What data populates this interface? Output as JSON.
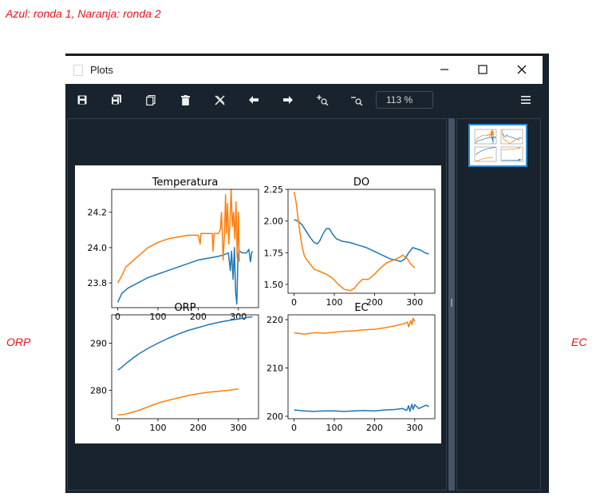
{
  "annotations": {
    "top": "Azul: ronda 1, Naranja: ronda 2",
    "left": "ORP",
    "right": "EC",
    "color": "#e8141b"
  },
  "window": {
    "title": "Plots",
    "minimize_icon": "minimize-icon",
    "maximize_icon": "maximize-icon",
    "close_icon": "close-icon"
  },
  "toolbar": {
    "buttons": [
      "save-icon",
      "save-all-icon",
      "copy-icon",
      "trash-icon",
      "close-all-icon",
      "arrow-left-icon",
      "arrow-right-icon",
      "zoom-in-icon",
      "zoom-out-icon"
    ],
    "zoom_value": "113 %",
    "menu_icon": "hamburger-menu-icon"
  },
  "colors": {
    "series1": "#1f77b4",
    "series2": "#ff7f0e",
    "pane_bg": "#19232d",
    "thumbnail_border": "#2d8ad6"
  },
  "chart_data": [
    {
      "type": "line",
      "title": "Temperatura",
      "xlim": [
        -15,
        350
      ],
      "ylim": [
        23.66,
        24.33
      ],
      "xticks": [
        0,
        100,
        200,
        300
      ],
      "yticks": [
        23.8,
        24.0,
        24.2
      ],
      "ytick_labels": [
        "23.8",
        "24.0",
        "24.2"
      ],
      "series": [
        {
          "color": "#1f77b4",
          "points": [
            [
              0,
              23.69
            ],
            [
              10,
              23.74
            ],
            [
              25,
              23.77
            ],
            [
              50,
              23.8
            ],
            [
              75,
              23.83
            ],
            [
              100,
              23.85
            ],
            [
              125,
              23.87
            ],
            [
              150,
              23.89
            ],
            [
              175,
              23.91
            ],
            [
              200,
              23.93
            ],
            [
              225,
              23.94
            ],
            [
              250,
              23.95
            ],
            [
              265,
              23.96
            ],
            [
              275,
              23.97
            ],
            [
              280,
              23.87
            ],
            [
              283,
              23.98
            ],
            [
              287,
              23.82
            ],
            [
              290,
              24.0
            ],
            [
              293,
              23.75
            ],
            [
              296,
              23.68
            ],
            [
              299,
              23.96
            ],
            [
              303,
              23.98
            ],
            [
              310,
              23.97
            ],
            [
              320,
              23.97
            ],
            [
              326,
              23.99
            ],
            [
              330,
              23.92
            ],
            [
              333,
              23.97
            ],
            [
              335,
              23.98
            ]
          ]
        },
        {
          "color": "#ff7f0e",
          "points": [
            [
              0,
              23.8
            ],
            [
              10,
              23.84
            ],
            [
              20,
              23.89
            ],
            [
              50,
              23.95
            ],
            [
              75,
              24.0
            ],
            [
              100,
              24.03
            ],
            [
              125,
              24.05
            ],
            [
              150,
              24.06
            ],
            [
              175,
              24.07
            ],
            [
              200,
              24.07
            ],
            [
              205,
              24.02
            ],
            [
              207,
              24.08
            ],
            [
              235,
              24.08
            ],
            [
              237,
              23.98
            ],
            [
              240,
              24.08
            ],
            [
              250,
              24.08
            ],
            [
              255,
              24.1
            ],
            [
              258,
              24.2
            ],
            [
              260,
              24.08
            ],
            [
              262,
              23.93
            ],
            [
              265,
              24.06
            ],
            [
              268,
              24.3
            ],
            [
              270,
              24.08
            ],
            [
              273,
              24.25
            ],
            [
              276,
              24.02
            ],
            [
              279,
              24.14
            ],
            [
              282,
              24.33
            ],
            [
              285,
              24.12
            ],
            [
              288,
              24.2
            ],
            [
              291,
              24.05
            ],
            [
              294,
              24.26
            ],
            [
              297,
              23.94
            ],
            [
              300,
              24.2
            ],
            [
              302,
              23.92
            ]
          ]
        }
      ]
    },
    {
      "type": "line",
      "title": "DO",
      "xlim": [
        -15,
        350
      ],
      "ylim": [
        1.43,
        2.25
      ],
      "xticks": [
        0,
        100,
        200,
        300
      ],
      "yticks": [
        1.5,
        1.75,
        2.0,
        2.25
      ],
      "ytick_labels": [
        "1.50",
        "1.75",
        "2.00",
        "2.25"
      ],
      "series": [
        {
          "color": "#1f77b4",
          "points": [
            [
              0,
              2.01
            ],
            [
              10,
              2.0
            ],
            [
              20,
              1.97
            ],
            [
              30,
              1.92
            ],
            [
              40,
              1.87
            ],
            [
              50,
              1.83
            ],
            [
              58,
              1.82
            ],
            [
              65,
              1.85
            ],
            [
              72,
              1.9
            ],
            [
              80,
              1.94
            ],
            [
              88,
              1.94
            ],
            [
              95,
              1.9
            ],
            [
              105,
              1.86
            ],
            [
              120,
              1.84
            ],
            [
              140,
              1.83
            ],
            [
              160,
              1.81
            ],
            [
              180,
              1.79
            ],
            [
              200,
              1.76
            ],
            [
              220,
              1.73
            ],
            [
              240,
              1.7
            ],
            [
              255,
              1.69
            ],
            [
              265,
              1.68
            ],
            [
              275,
              1.7
            ],
            [
              285,
              1.75
            ],
            [
              295,
              1.79
            ],
            [
              305,
              1.78
            ],
            [
              315,
              1.77
            ],
            [
              325,
              1.75
            ],
            [
              335,
              1.74
            ]
          ]
        },
        {
          "color": "#ff7f0e",
          "points": [
            [
              0,
              2.23
            ],
            [
              5,
              2.15
            ],
            [
              10,
              2.02
            ],
            [
              15,
              1.9
            ],
            [
              20,
              1.8
            ],
            [
              25,
              1.73
            ],
            [
              30,
              1.7
            ],
            [
              40,
              1.66
            ],
            [
              50,
              1.62
            ],
            [
              65,
              1.6
            ],
            [
              80,
              1.58
            ],
            [
              95,
              1.55
            ],
            [
              110,
              1.5
            ],
            [
              125,
              1.46
            ],
            [
              140,
              1.45
            ],
            [
              150,
              1.47
            ],
            [
              160,
              1.51
            ],
            [
              170,
              1.54
            ],
            [
              185,
              1.54
            ],
            [
              200,
              1.58
            ],
            [
              215,
              1.63
            ],
            [
              230,
              1.67
            ],
            [
              245,
              1.69
            ],
            [
              260,
              1.71
            ],
            [
              270,
              1.73
            ],
            [
              280,
              1.71
            ],
            [
              290,
              1.66
            ],
            [
              300,
              1.63
            ]
          ]
        }
      ]
    },
    {
      "type": "line",
      "title": "ORP",
      "xlim": [
        -15,
        350
      ],
      "ylim": [
        274,
        296
      ],
      "xticks": [
        0,
        100,
        200,
        300
      ],
      "yticks": [
        280,
        290
      ],
      "ytick_labels": [
        "280",
        "290"
      ],
      "series": [
        {
          "color": "#1f77b4",
          "points": [
            [
              0,
              284.3
            ],
            [
              10,
              284.9
            ],
            [
              25,
              286.0
            ],
            [
              50,
              287.6
            ],
            [
              75,
              288.9
            ],
            [
              100,
              290.0
            ],
            [
              125,
              291.0
            ],
            [
              150,
              291.9
            ],
            [
              175,
              292.7
            ],
            [
              200,
              293.3
            ],
            [
              225,
              293.9
            ],
            [
              250,
              294.4
            ],
            [
              275,
              294.8
            ],
            [
              300,
              295.1
            ],
            [
              320,
              295.4
            ],
            [
              335,
              295.6
            ]
          ]
        },
        {
          "color": "#ff7f0e",
          "points": [
            [
              0,
              274.8
            ],
            [
              15,
              274.9
            ],
            [
              30,
              275.2
            ],
            [
              50,
              275.7
            ],
            [
              75,
              276.5
            ],
            [
              100,
              277.3
            ],
            [
              125,
              277.9
            ],
            [
              150,
              278.4
            ],
            [
              175,
              278.9
            ],
            [
              200,
              279.3
            ],
            [
              225,
              279.6
            ],
            [
              250,
              279.8
            ],
            [
              275,
              280.0
            ],
            [
              290,
              280.2
            ],
            [
              300,
              280.3
            ]
          ]
        }
      ]
    },
    {
      "type": "line",
      "title": "EC",
      "xlim": [
        -15,
        350
      ],
      "ylim": [
        199.5,
        221
      ],
      "xticks": [
        0,
        100,
        200,
        300
      ],
      "yticks": [
        200,
        210,
        220
      ],
      "ytick_labels": [
        "200",
        "210",
        "220"
      ],
      "series": [
        {
          "color": "#1f77b4",
          "points": [
            [
              0,
              201.3
            ],
            [
              25,
              201.1
            ],
            [
              50,
              201.0
            ],
            [
              75,
              201.1
            ],
            [
              100,
              201.1
            ],
            [
              125,
              201.0
            ],
            [
              150,
              201.1
            ],
            [
              175,
              201.2
            ],
            [
              200,
              201.1
            ],
            [
              225,
              201.3
            ],
            [
              250,
              201.4
            ],
            [
              270,
              201.6
            ],
            [
              280,
              201.2
            ],
            [
              285,
              202.2
            ],
            [
              288,
              201.0
            ],
            [
              293,
              202.5
            ],
            [
              296,
              201.4
            ],
            [
              300,
              202.4
            ],
            [
              310,
              201.6
            ],
            [
              320,
              202.0
            ],
            [
              328,
              202.3
            ],
            [
              335,
              202.0
            ]
          ]
        },
        {
          "color": "#ff7f0e",
          "points": [
            [
              0,
              217.3
            ],
            [
              25,
              217.0
            ],
            [
              50,
              217.3
            ],
            [
              75,
              217.2
            ],
            [
              100,
              217.4
            ],
            [
              125,
              217.6
            ],
            [
              150,
              217.7
            ],
            [
              175,
              217.9
            ],
            [
              200,
              218.0
            ],
            [
              225,
              218.3
            ],
            [
              250,
              218.7
            ],
            [
              265,
              219.0
            ],
            [
              275,
              219.2
            ],
            [
              282,
              219.5
            ],
            [
              285,
              218.5
            ],
            [
              290,
              219.8
            ],
            [
              293,
              219.0
            ],
            [
              296,
              220.3
            ],
            [
              300,
              219.6
            ]
          ]
        }
      ]
    }
  ]
}
